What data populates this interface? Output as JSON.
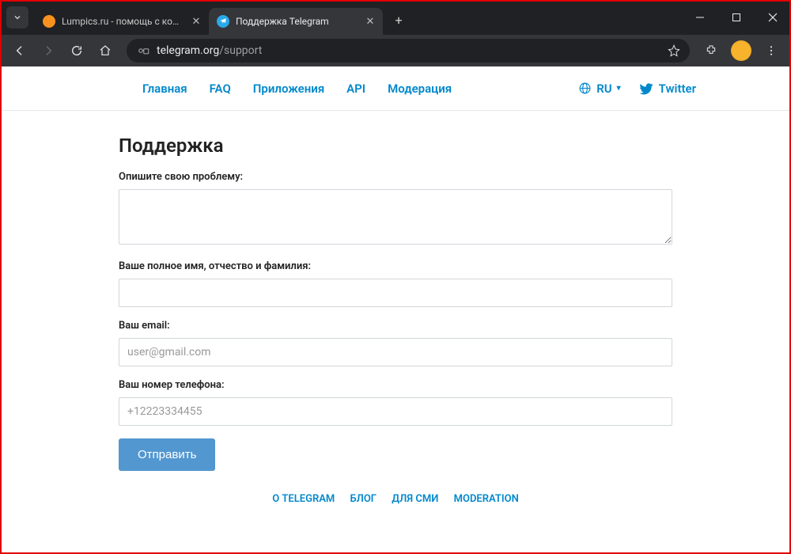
{
  "browser": {
    "tabs": [
      {
        "title": "Lumpics.ru - помощь с компь",
        "favicon_color": "#f7921e",
        "active": false
      },
      {
        "title": "Поддержка Telegram",
        "favicon_color": "#29a9ea",
        "active": true
      }
    ],
    "url_domain": "telegram.org",
    "url_path": "/support"
  },
  "nav": {
    "links": [
      "Главная",
      "FAQ",
      "Приложения",
      "API",
      "Модерация"
    ],
    "lang": "RU",
    "twitter": "Twitter"
  },
  "form": {
    "heading": "Поддержка",
    "problem_label": "Опишите свою проблему:",
    "name_label": "Ваше полное имя, отчество и фамилия:",
    "email_label": "Ваш email:",
    "email_placeholder": "user@gmail.com",
    "phone_label": "Ваш номер телефона:",
    "phone_placeholder": "+12223334455",
    "submit": "Отправить"
  },
  "footer": {
    "links": [
      "О TELEGRAM",
      "БЛОГ",
      "ДЛЯ СМИ",
      "MODERATION"
    ]
  }
}
